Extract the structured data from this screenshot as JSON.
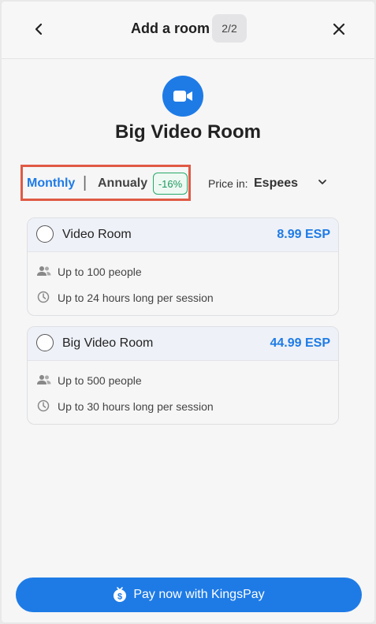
{
  "header": {
    "title": "Add a room",
    "step": "2/2"
  },
  "room": {
    "title": "Big Video Room",
    "icon": "video-camera-icon"
  },
  "billing": {
    "monthly_label": "Monthly",
    "separator": "|",
    "annual_label": "Annualy",
    "discount": "-16%",
    "selected": "Monthly"
  },
  "currency": {
    "label": "Price in:",
    "value": "Espees"
  },
  "plans": [
    {
      "name": "Video Room",
      "price": "8.99 ESP",
      "features": [
        "Up to 100 people",
        "Up to 24 hours long per session"
      ]
    },
    {
      "name": "Big Video Room",
      "price": "44.99 ESP",
      "features": [
        "Up to 500 people",
        "Up to 30 hours long per session"
      ]
    }
  ],
  "pay_button": {
    "label": "Pay now with KingsPay",
    "icon": "dollar-coin-icon"
  },
  "colors": {
    "accent": "#1e7be6",
    "discount": "#1e9a5d",
    "highlight_box": "#e05a44"
  }
}
